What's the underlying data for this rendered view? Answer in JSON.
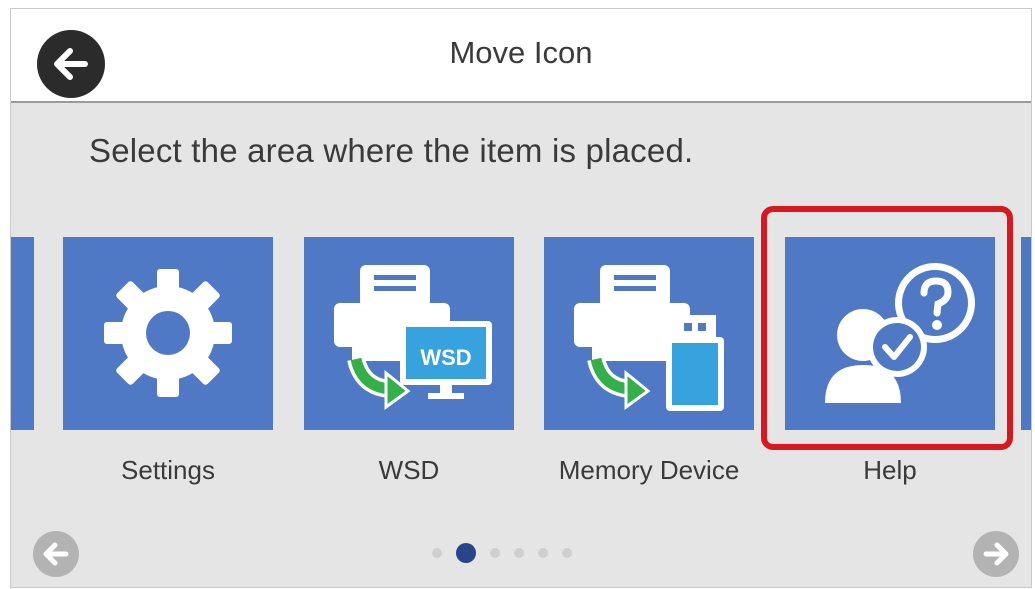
{
  "header": {
    "title": "Move Icon",
    "back_icon": "back-arrow-icon"
  },
  "instruction": "Select the area where the item is placed.",
  "tiles": [
    {
      "label": "Settings",
      "icon": "gear-icon"
    },
    {
      "label": "WSD",
      "icon": "wsd-scan-icon",
      "icon_text": "WSD"
    },
    {
      "label": "Memory Device",
      "icon": "memory-device-icon"
    },
    {
      "label": "Help",
      "icon": "help-icon",
      "highlighted": true
    }
  ],
  "pager": {
    "total": 6,
    "current": 2
  },
  "nav": {
    "prev_icon": "left-arrow-icon",
    "next_icon": "right-arrow-icon"
  },
  "colors": {
    "tile": "#4f79c5",
    "highlight": "#d7191f",
    "background": "#e5e5e5",
    "active_dot": "#27458a",
    "green_arrow": "#33b04a"
  }
}
